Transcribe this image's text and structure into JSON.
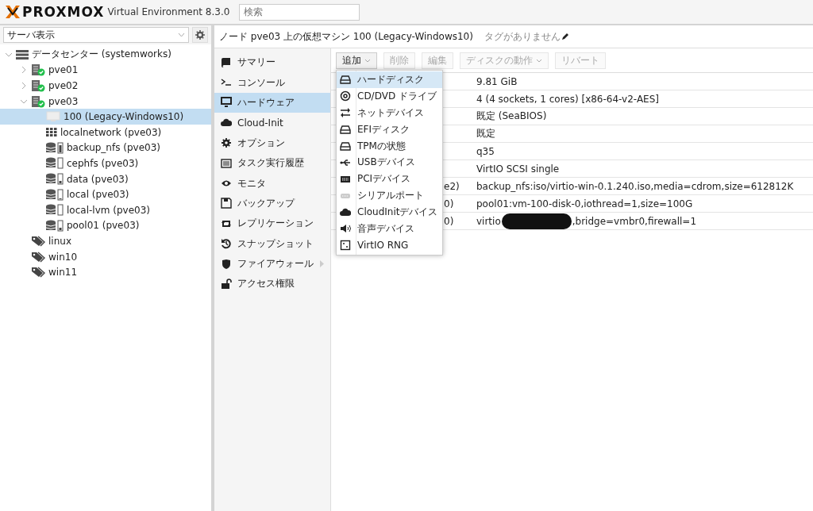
{
  "header": {
    "logo": "PROXMOX",
    "product": "Virtual Environment 8.3.0",
    "search": {
      "placeholder": "検索"
    }
  },
  "sidebar": {
    "view_select": "サーバ表示",
    "tree": [
      {
        "label": "データセンター (systemworks)",
        "kind": "datacenter",
        "expanded": true,
        "selected": false,
        "children": [
          {
            "label": "pve01",
            "kind": "node",
            "online": true,
            "expanded": false,
            "selected": false
          },
          {
            "label": "pve02",
            "kind": "node",
            "online": true,
            "expanded": false,
            "selected": false
          },
          {
            "label": "pve03",
            "kind": "node",
            "online": true,
            "expanded": true,
            "selected": false,
            "children": [
              {
                "label": "100 (Legacy-Windows10)",
                "kind": "vm",
                "selected": true
              },
              {
                "label": "localnetwork (pve03)",
                "kind": "sdn",
                "selected": false
              },
              {
                "label": "backup_nfs (pve03)",
                "kind": "storage",
                "level": 0.85,
                "selected": false
              },
              {
                "label": "cephfs (pve03)",
                "kind": "storage",
                "selected": false
              },
              {
                "label": "data (pve03)",
                "kind": "storage",
                "level": 0.25,
                "selected": false
              },
              {
                "label": "local (pve03)",
                "kind": "storage",
                "level": 0.05,
                "selected": false
              },
              {
                "label": "local-lvm (pve03)",
                "kind": "storage",
                "selected": false
              },
              {
                "label": "pool01 (pve03)",
                "kind": "storage",
                "level": 0.25,
                "selected": false
              }
            ]
          },
          {
            "label": "linux",
            "kind": "tag",
            "selected": false
          },
          {
            "label": "win10",
            "kind": "tag",
            "selected": false
          },
          {
            "label": "win11",
            "kind": "tag",
            "selected": false
          }
        ]
      }
    ]
  },
  "content": {
    "title": "ノード pve03 上の仮想マシン 100 (Legacy-Windows10)",
    "tags": "タグがありません",
    "nav": [
      {
        "label": "サマリー",
        "selected": false
      },
      {
        "label": "コンソール",
        "selected": false
      },
      {
        "label": "ハードウェア",
        "selected": true
      },
      {
        "label": "Cloud-Init",
        "selected": false
      },
      {
        "label": "オプション",
        "selected": false
      },
      {
        "label": "タスク実行履歴",
        "selected": false
      },
      {
        "label": "モニタ",
        "selected": false
      },
      {
        "label": "バックアップ",
        "selected": false
      },
      {
        "label": "レプリケーション",
        "selected": false
      },
      {
        "label": "スナップショット",
        "selected": false
      },
      {
        "label": "ファイアウォール",
        "selected": false,
        "expandable": true
      },
      {
        "label": "アクセス権限",
        "selected": false
      }
    ],
    "toolbar": [
      {
        "label": "追加",
        "dropdown": true,
        "disabled": false
      },
      {
        "label": "削除",
        "dropdown": false,
        "disabled": true
      },
      {
        "label": "編集",
        "dropdown": false,
        "disabled": true
      },
      {
        "label": "ディスクの動作",
        "dropdown": true,
        "disabled": true
      },
      {
        "label": "リバート",
        "dropdown": false,
        "disabled": true
      }
    ],
    "rows": [
      {
        "value": "9.81 GiB"
      },
      {
        "value": "4 (4 sockets, 1 cores) [x86-64-v2-AES]"
      },
      {
        "value": "既定 (SeaBIOS)"
      },
      {
        "value": "既定"
      },
      {
        "value": "q35"
      },
      {
        "value": "VirtIO SCSI single"
      },
      {
        "key": "e2)",
        "value": "backup_nfs:iso/virtio-win-0.1.240.iso,media=cdrom,size=612812K"
      },
      {
        "key": "0)",
        "value": "pool01:vm-100-disk-0,iothread=1,size=100G"
      },
      {
        "key": "0)",
        "value": "virtio",
        "redacted": true,
        "value_after": ",bridge=vmbr0,firewall=1"
      }
    ],
    "add_menu": [
      {
        "label": "ハードディスク",
        "selected": true
      },
      {
        "label": "CD/DVD ドライブ",
        "selected": false
      },
      {
        "label": "ネットデバイス",
        "selected": false
      },
      {
        "label": "EFIディスク",
        "selected": false
      },
      {
        "label": "TPMの状態",
        "selected": false
      },
      {
        "label": "USBデバイス",
        "selected": false
      },
      {
        "label": "PCIデバイス",
        "selected": false
      },
      {
        "label": "シリアルポート",
        "selected": false
      },
      {
        "label": "CloudInitデバイス",
        "selected": false
      },
      {
        "label": "音声デバイス",
        "selected": false
      },
      {
        "label": "VirtIO RNG",
        "selected": false
      }
    ]
  }
}
